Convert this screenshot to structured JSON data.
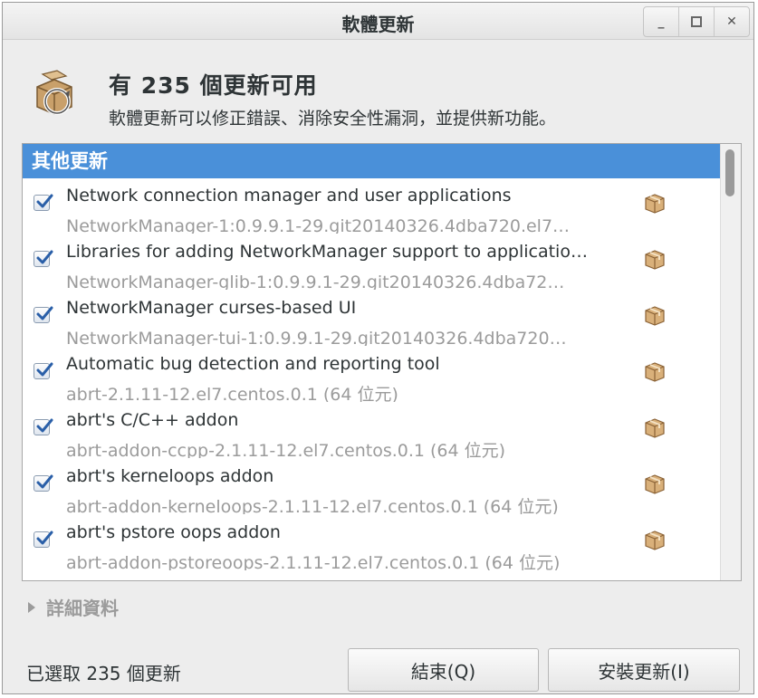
{
  "window": {
    "title": "軟體更新",
    "controls": {
      "minimize": "_",
      "close": "✕"
    }
  },
  "header": {
    "title": "有 235 個更新可用",
    "subtitle": "軟體更新可以修正錯誤、消除安全性漏洞，並提供新功能。"
  },
  "section": {
    "label": "其他更新"
  },
  "updates": [
    {
      "summary": "Network connection manager and user applications",
      "detail": "NetworkManager-1:0.9.9.1-29.git20140326.4dba720.el7…",
      "checked": true
    },
    {
      "summary": "Libraries for adding NetworkManager support to applicatio…",
      "detail": "NetworkManager-glib-1:0.9.9.1-29.git20140326.4dba72…",
      "checked": true
    },
    {
      "summary": "NetworkManager curses-based UI",
      "detail": "NetworkManager-tui-1:0.9.9.1-29.git20140326.4dba720…",
      "checked": true
    },
    {
      "summary": "Automatic bug detection and reporting tool",
      "detail": "abrt-2.1.11-12.el7.centos.0.1 (64 位元)",
      "checked": true
    },
    {
      "summary": "abrt's C/C++ addon",
      "detail": "abrt-addon-ccpp-2.1.11-12.el7.centos.0.1 (64 位元)",
      "checked": true
    },
    {
      "summary": "abrt's kerneloops addon",
      "detail": "abrt-addon-kerneloops-2.1.11-12.el7.centos.0.1 (64 位元)",
      "checked": true
    },
    {
      "summary": "abrt's pstore oops addon",
      "detail": "abrt-addon-pstoreoops-2.1.11-12.el7.centos.0.1 (64 位元)",
      "checked": true
    }
  ],
  "details": {
    "label": "詳細資料"
  },
  "footer": {
    "status": "已選取 235 個更新",
    "close_label": "結束(Q)",
    "install_label": "安裝更新(I)"
  },
  "colors": {
    "section_header": "#4a90d9",
    "window_bg": "#ededed",
    "secondary_text": "#9b9b9b"
  },
  "icons": {
    "header": "software-update-package-icon",
    "row": "package-icon",
    "check": "checkmark-icon"
  }
}
